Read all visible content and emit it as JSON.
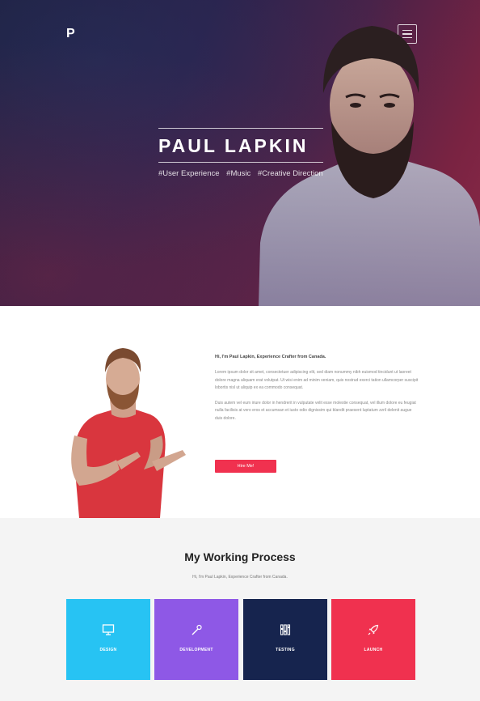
{
  "hero": {
    "logo_text": "P",
    "name": "PAUL LAPKIN",
    "tags": [
      "#User Experience",
      "#Music",
      "#Creative Direction"
    ]
  },
  "about": {
    "heading": "Hi, I'm Paul Lapkin, Experience Crafter from Canada.",
    "paragraph_1": "Lorem ipsum dolor sit amet, consectetuer adipiscing elit, sed diam nonummy nibh euismod tincidunt ut laoreet dolore magna aliquam erat volutpat. Ut wisi enim ad minim veniam, quis nostrud exerci tation ullamcorper suscipit lobortis nisl ut aliquip ex ea commodo consequat.",
    "paragraph_2": "Duis autem vel eum iriure dolor in hendrerit in vulputate velit esse molestie consequat, vel illum dolore eu feugiat nulla facilisis at vero eros et accumsan et iusto odio dignissim qui blandit praesent luptatum zzril delenit augue duis dolore.",
    "button_label": "Hire Me!"
  },
  "process": {
    "title": "My Working Process",
    "subtitle": "Hi, I'm Paul Lapkin, Experience Crafter from Canada.",
    "cards": [
      {
        "label": "DESIGN",
        "color": "#27c3f3",
        "icon": "monitor-icon"
      },
      {
        "label": "DEVELOPMENT",
        "color": "#8e58e6",
        "icon": "magic-wand-icon"
      },
      {
        "label": "TESTING",
        "color": "#16244e",
        "icon": "sliders-icon"
      },
      {
        "label": "LAUNCH",
        "color": "#f0314f",
        "icon": "rocket-icon"
      }
    ]
  }
}
